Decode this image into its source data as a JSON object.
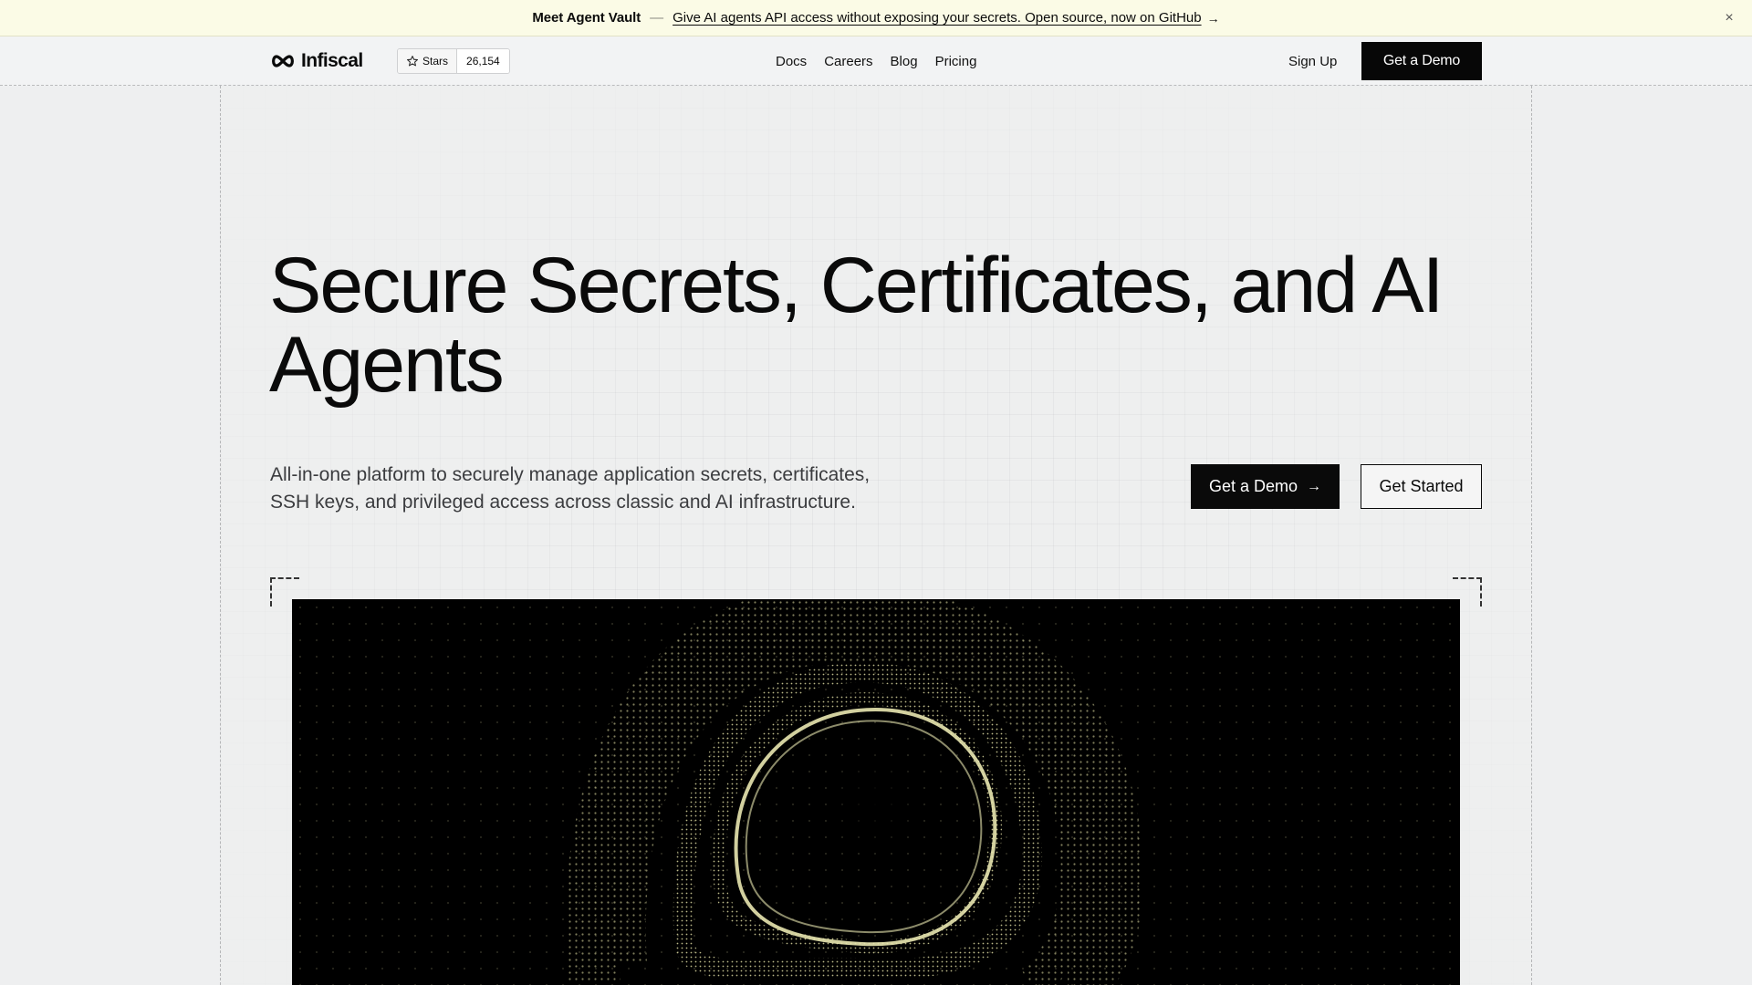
{
  "announcement": {
    "lead": "Meet Agent Vault",
    "separator": "—",
    "message": "Give AI agents API access without exposing your secrets. Open source, now on GitHub",
    "arrow": "→",
    "close": "×"
  },
  "nav": {
    "logo_text": "Infiscal",
    "github": {
      "label": "Stars",
      "count": "26,154"
    },
    "links": [
      "Docs",
      "Careers",
      "Blog",
      "Pricing"
    ],
    "sign_up": "Sign Up",
    "cta": "Get a Demo"
  },
  "hero": {
    "headline": "Secure Secrets, Certificates, and AI Agents",
    "subtext": "All-in-one platform to securely manage application secrets, certificates, SSH keys, and privileged access across classic and AI infrastructure.",
    "primary_cta": "Get a Demo",
    "primary_cta_arrow": "→",
    "secondary_cta": "Get Started"
  },
  "colors": {
    "accent_dots": "#e6e4a8",
    "dark": "#0a0a0a",
    "banner": "#fbfbe6"
  }
}
